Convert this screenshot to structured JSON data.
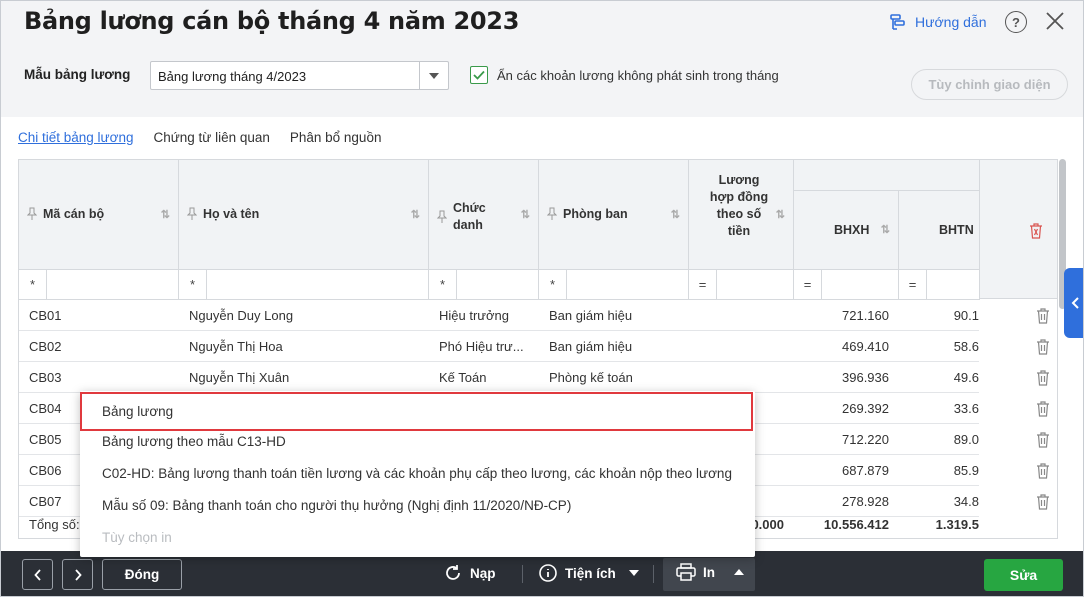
{
  "title": "Bảng lương cán bộ tháng 4 năm 2023",
  "header": {
    "help_label": "Hướng dẫn",
    "help_q": "?",
    "template_label": "Mẫu bảng lương",
    "template_value": "Bảng lương tháng 4/2023",
    "hide_checkbox_label": "Ẩn các khoản lương không phát sinh trong tháng",
    "hide_checked": true,
    "customize_label": "Tùy chỉnh giao diện"
  },
  "tabs": [
    "Chi tiết bảng lương",
    "Chứng từ liên quan",
    "Phân bổ nguồn"
  ],
  "grid": {
    "columns": [
      "Mã cán bộ",
      "Họ và tên",
      "Chức danh",
      "Phòng ban",
      "Lương hợp đồng theo số tiền",
      "BHXH",
      "BHTN"
    ],
    "filters": [
      "*",
      "*",
      "*",
      "*",
      "=",
      "=",
      "="
    ],
    "rows": [
      {
        "code": "CB01",
        "name": "Nguyễn Duy Long",
        "title": "Hiệu trưởng",
        "dept": "Ban giám hiệu",
        "salary": "",
        "bhxh": "721.160",
        "bhtn": "90.1"
      },
      {
        "code": "CB02",
        "name": "Nguyễn Thị Hoa",
        "title": "Phó Hiệu trư...",
        "dept": "Ban giám hiệu",
        "salary": "",
        "bhxh": "469.410",
        "bhtn": "58.6"
      },
      {
        "code": "CB03",
        "name": "Nguyễn Thị Xuân",
        "title": "Kế Toán",
        "dept": "Phòng kế toán",
        "salary": "",
        "bhxh": "396.936",
        "bhtn": "49.6"
      },
      {
        "code": "CB04",
        "name": "",
        "title": "",
        "dept": "",
        "salary": "",
        "bhxh": "269.392",
        "bhtn": "33.6"
      },
      {
        "code": "CB05",
        "name": "",
        "title": "",
        "dept": "",
        "salary": "",
        "bhxh": "712.220",
        "bhtn": "89.0"
      },
      {
        "code": "CB06",
        "name": "",
        "title": "",
        "dept": "",
        "salary": "",
        "bhxh": "687.879",
        "bhtn": "85.9"
      },
      {
        "code": "CB07",
        "name": "",
        "title": "",
        "dept": "",
        "salary": "",
        "bhxh": "278.928",
        "bhtn": "34.8"
      }
    ],
    "total_label": "Tổng số:",
    "total_salary": "0.000",
    "total_bhxh": "10.556.412",
    "total_bhtn": "1.319.5"
  },
  "print_menu": {
    "items": [
      "Bảng lương",
      "Bảng lương theo mẫu C13-HD",
      "C02-HD: Bảng lương thanh toán tiền lương và các khoản phụ cấp theo lương, các khoản nộp theo lương",
      "Mẫu số 09: Bảng thanh toán cho người thụ hưởng (Nghị định 11/2020/NĐ-CP)"
    ],
    "disabled_item": "Tùy chọn in",
    "highlighted_index": 0
  },
  "footer": {
    "close_label": "Đóng",
    "reload_label": "Nạp",
    "utility_label": "Tiện ích",
    "print_label": "In",
    "edit_label": "Sửa"
  },
  "colors": {
    "accent": "#2f6fdc",
    "save": "#27a641",
    "footer": "#2b2f36",
    "highlight": "#e0393e"
  }
}
